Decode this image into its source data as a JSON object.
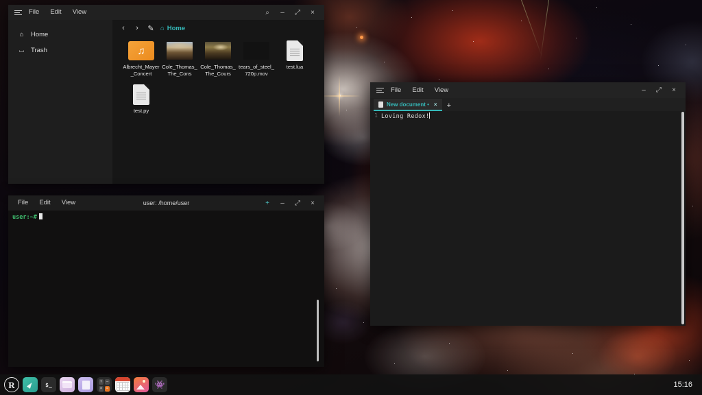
{
  "desktop": {
    "wallpaper_name": "tarantula-nebula-wallpaper"
  },
  "file_manager": {
    "window_name": "File Manager",
    "menu": [
      {
        "label": "File",
        "name": "fm-menu-file"
      },
      {
        "label": "Edit",
        "name": "fm-menu-edit"
      },
      {
        "label": "View",
        "name": "fm-menu-view"
      }
    ],
    "window_controls": {
      "search": "⌕",
      "minimize": "–",
      "maximize": "⤢",
      "close": "×"
    },
    "sidebar": [
      {
        "label": "Home",
        "icon": "home-icon",
        "glyph": "⌂"
      },
      {
        "label": "Trash",
        "icon": "trash-icon",
        "glyph": "⌴"
      }
    ],
    "toolbar": {
      "back": "‹",
      "forward": "›",
      "edit_path": "✎",
      "breadcrumb_glyph": "⌂",
      "breadcrumb": "Home"
    },
    "files": [
      {
        "name": "Albrecht_Mayer_Concert",
        "kind": "music"
      },
      {
        "name": "Cole_Thomas_The_Cons",
        "kind": "painting1"
      },
      {
        "name": "Cole_Thomas_The_Cours",
        "kind": "painting2"
      },
      {
        "name": "tears_of_steel_720p.mov",
        "kind": "blank"
      },
      {
        "name": "test.lua",
        "kind": "doc"
      },
      {
        "name": "test.py",
        "kind": "doc"
      }
    ]
  },
  "editor": {
    "window_name": "Text Editor",
    "menu": [
      {
        "label": "File",
        "name": "ed-menu-file"
      },
      {
        "label": "Edit",
        "name": "ed-menu-edit"
      },
      {
        "label": "View",
        "name": "ed-menu-view"
      }
    ],
    "window_controls": {
      "minimize": "–",
      "maximize": "⤢",
      "close": "×"
    },
    "tab": {
      "title": "New document •",
      "close": "×"
    },
    "new_tab": "+",
    "line_number": "1",
    "content": "Loving Redox!",
    "accent_color": "#35b8b8"
  },
  "terminal": {
    "window_name": "Terminal",
    "menu": [
      {
        "label": "File",
        "name": "term-menu-file"
      },
      {
        "label": "Edit",
        "name": "term-menu-edit"
      },
      {
        "label": "View",
        "name": "term-menu-view"
      }
    ],
    "title": "user: /home/user",
    "window_controls": {
      "new_tab": "+",
      "minimize": "–",
      "maximize": "⤢",
      "close": "×"
    },
    "prompt": "user:~#",
    "prompt_color": "#3fbf6f"
  },
  "taskbar": {
    "items": [
      {
        "name": "redox-logo-icon",
        "label": "R"
      },
      {
        "name": "browser-icon",
        "label": ""
      },
      {
        "name": "terminal-icon",
        "label": "$_"
      },
      {
        "name": "file-manager-icon",
        "label": ""
      },
      {
        "name": "text-editor-icon",
        "label": ""
      },
      {
        "name": "calculator-icon",
        "label": ""
      },
      {
        "name": "calendar-icon",
        "label": ""
      },
      {
        "name": "image-viewer-icon",
        "label": ""
      },
      {
        "name": "game-icon",
        "label": "👾"
      }
    ],
    "calculator_keys": [
      "+",
      "–",
      "×",
      "="
    ],
    "clock": "15:16"
  }
}
